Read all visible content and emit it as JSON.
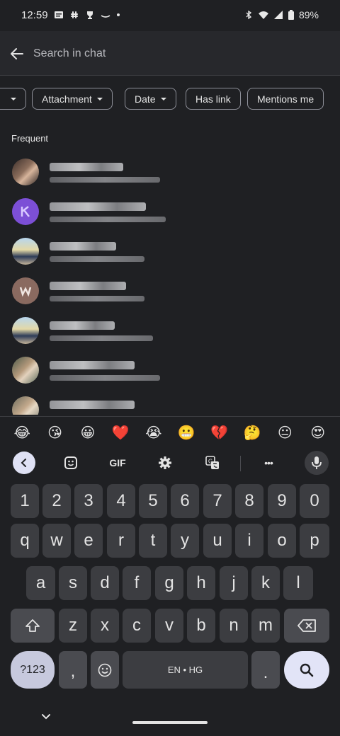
{
  "status_bar": {
    "time": "12:59",
    "battery": "89%"
  },
  "header": {
    "search_placeholder": "Search in chat"
  },
  "filters": [
    "Attachment",
    "Date",
    "Has link",
    "Mentions me"
  ],
  "section_label": "Frequent",
  "emoji_suggestions": [
    "😂",
    "😘",
    "😀",
    "❤️",
    "😭",
    "😬",
    "💔",
    "🤔",
    "😐",
    "😍"
  ],
  "keyboard": {
    "toolbar": {
      "gif_label": "GIF",
      "more_label": "•••"
    },
    "number_row": [
      "1",
      "2",
      "3",
      "4",
      "5",
      "6",
      "7",
      "8",
      "9",
      "0"
    ],
    "row1": [
      "q",
      "w",
      "e",
      "r",
      "t",
      "y",
      "u",
      "i",
      "o",
      "p"
    ],
    "row2": [
      "a",
      "s",
      "d",
      "f",
      "g",
      "h",
      "j",
      "k",
      "l"
    ],
    "row3": [
      "z",
      "x",
      "c",
      "v",
      "b",
      "n",
      "m"
    ],
    "mode_key": "?123",
    "comma": ",",
    "period": ".",
    "space_label": "EN • HG"
  },
  "colors": {
    "background": "#1f2023",
    "header": "#27282c",
    "key": "#3c3d41",
    "accent_key": "#e2e4f7"
  }
}
